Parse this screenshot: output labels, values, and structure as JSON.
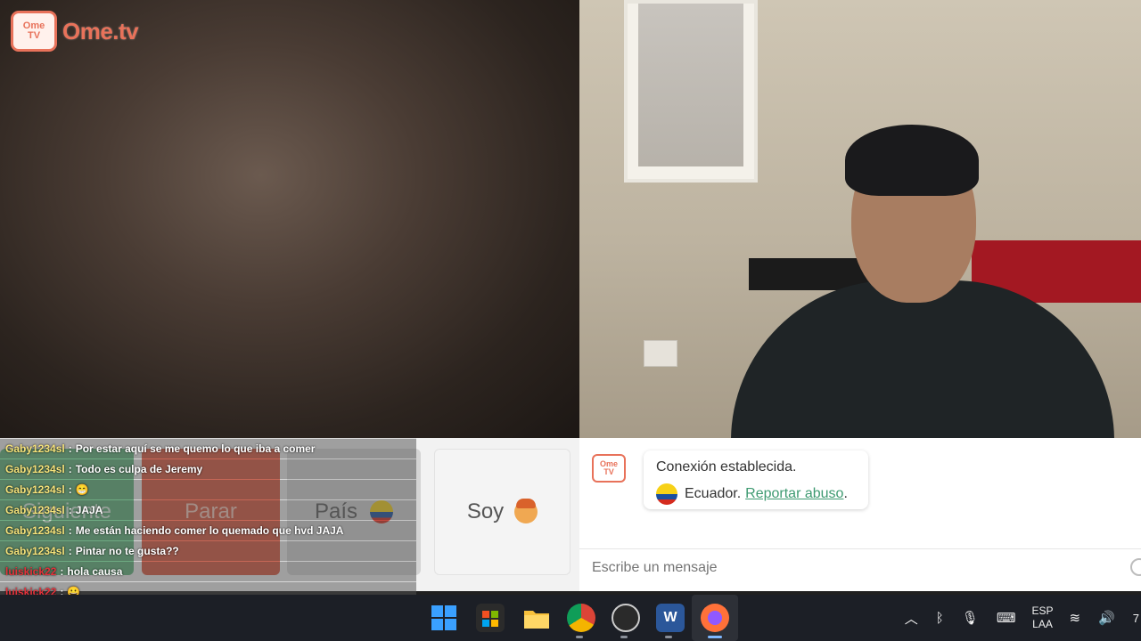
{
  "brand": {
    "logo_line1": "Ome",
    "logo_line2": "TV",
    "logo_text": "Ome.tv"
  },
  "controls": {
    "next_label": "Siguiente",
    "stop_label": "Parar",
    "country_label": "País",
    "soy_label": "Soy"
  },
  "stream_chat": [
    {
      "user": "Gaby1234sl",
      "sep": ":",
      "text": "Por estar aquí se me quemo lo que iba a comer"
    },
    {
      "user": "Gaby1234sl",
      "sep": ":",
      "text": "Todo es culpa de Jeremy"
    },
    {
      "user": "Gaby1234sl",
      "sep": ":",
      "text": "😁"
    },
    {
      "user": "Gaby1234sl",
      "sep": ":",
      "text": "JAJA"
    },
    {
      "user": "Gaby1234sl",
      "sep": ":",
      "text": "Me están haciendo comer lo quemado que hvd JAJA"
    },
    {
      "user": "Gaby1234sl",
      "sep": ":",
      "text": "Pintar no te gusta??"
    },
    {
      "user": "luiskick22",
      "sep": ":",
      "text": "hola causa"
    },
    {
      "user": "luiskick22",
      "sep": ":",
      "text": "😀"
    }
  ],
  "chat_panel": {
    "logo_line1": "Ome",
    "logo_line2": "TV",
    "status": "Conexión establecida.",
    "country": "Ecuador.",
    "report_link": "Reportar abuso",
    "report_suffix": ".",
    "input_placeholder": "Escribe un mensaje"
  },
  "taskbar": {
    "icons": [
      "windows-start-icon",
      "microsoft-store-icon",
      "file-explorer-icon",
      "chrome-icon",
      "obs-icon",
      "word-icon",
      "firefox-icon"
    ],
    "word_letter": "W",
    "lang_top": "ESP",
    "lang_bottom": "LAA",
    "clock_partial": "7"
  },
  "colors": {
    "brand": "#e8725a",
    "next": "#5fb27a",
    "stop": "#d9553e",
    "link": "#3e9a71"
  }
}
